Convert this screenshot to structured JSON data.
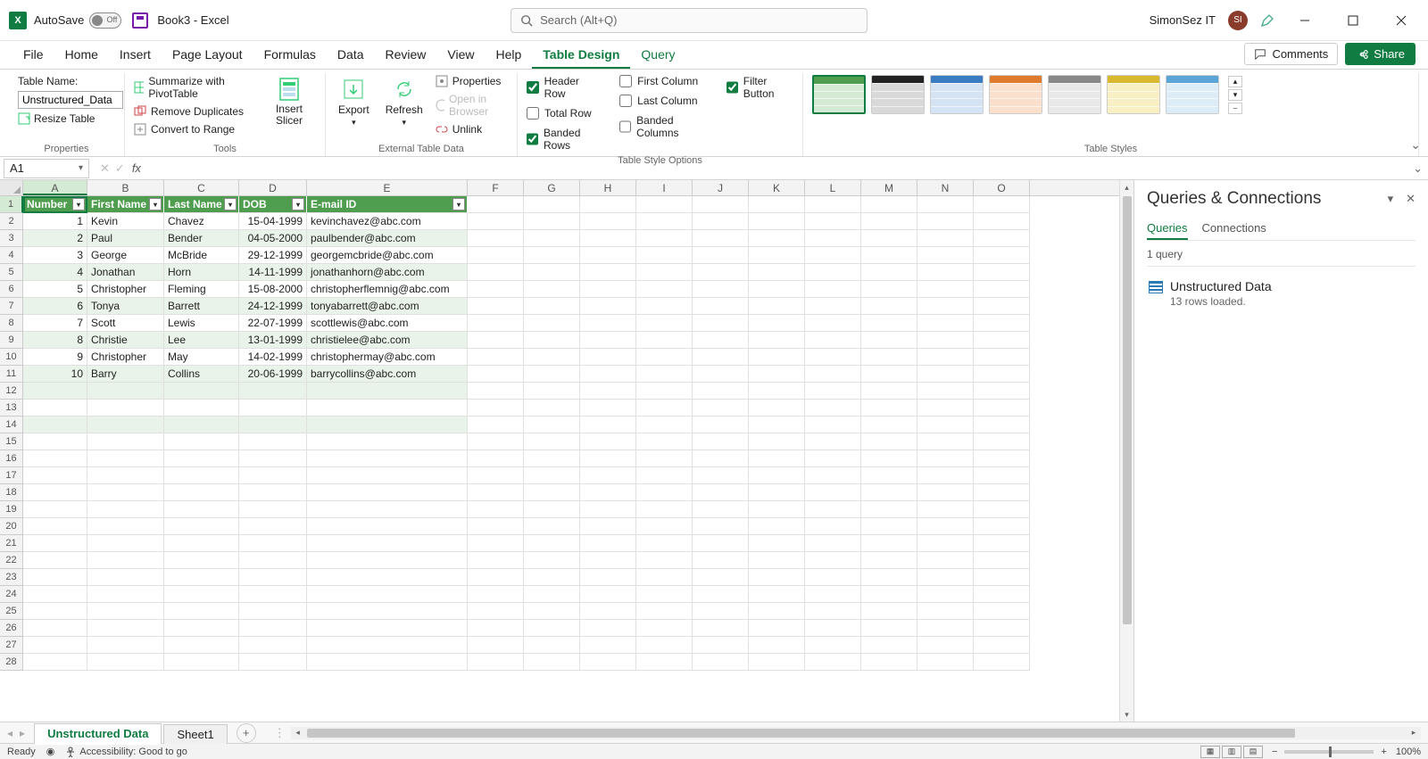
{
  "titlebar": {
    "autosave_label": "AutoSave",
    "autosave_state": "Off",
    "document_title": "Book3  -  Excel",
    "search_placeholder": "Search (Alt+Q)",
    "account_name": "SimonSez IT",
    "account_initials": "SI"
  },
  "ribbon_tabs": [
    "File",
    "Home",
    "Insert",
    "Page Layout",
    "Formulas",
    "Data",
    "Review",
    "View",
    "Help",
    "Table Design",
    "Query"
  ],
  "ribbon_active_tab": "Table Design",
  "ribbon_right": {
    "comments": "Comments",
    "share": "Share"
  },
  "ribbon": {
    "properties": {
      "table_name_label": "Table Name:",
      "table_name_value": "Unstructured_Data",
      "resize_table": "Resize Table",
      "group_label": "Properties"
    },
    "tools": {
      "summarize": "Summarize with PivotTable",
      "remove_dup": "Remove Duplicates",
      "convert_range": "Convert to Range",
      "insert_slicer": "Insert Slicer",
      "group_label": "Tools"
    },
    "external": {
      "export": "Export",
      "refresh": "Refresh",
      "properties": "Properties",
      "open_browser": "Open in Browser",
      "unlink": "Unlink",
      "group_label": "External Table Data"
    },
    "style_options": {
      "header_row": "Header Row",
      "total_row": "Total Row",
      "banded_rows": "Banded Rows",
      "first_col": "First Column",
      "last_col": "Last Column",
      "banded_cols": "Banded Columns",
      "filter_btn": "Filter Button",
      "group_label": "Table Style Options"
    },
    "styles_label": "Table Styles"
  },
  "namebox": "A1",
  "columns": [
    "A",
    "B",
    "C",
    "D",
    "E",
    "F",
    "G",
    "H",
    "I",
    "J",
    "K",
    "L",
    "M",
    "N",
    "O"
  ],
  "table_headers": [
    "Number",
    "First Name",
    "Last Name",
    "DOB",
    "E-mail ID"
  ],
  "rows": [
    {
      "n": "1",
      "fn": "Kevin",
      "ln": "Chavez",
      "dob": "15-04-1999",
      "em": "kevinchavez@abc.com"
    },
    {
      "n": "2",
      "fn": "Paul",
      "ln": "Bender",
      "dob": "04-05-2000",
      "em": "paulbender@abc.com"
    },
    {
      "n": "3",
      "fn": "George",
      "ln": "McBride",
      "dob": "29-12-1999",
      "em": "georgemcbride@abc.com"
    },
    {
      "n": "4",
      "fn": "Jonathan",
      "ln": "Horn",
      "dob": "14-11-1999",
      "em": "jonathanhorn@abc.com"
    },
    {
      "n": "5",
      "fn": "Christopher",
      "ln": "Fleming",
      "dob": "15-08-2000",
      "em": "christopherflemnig@abc.com"
    },
    {
      "n": "6",
      "fn": "Tonya",
      "ln": "Barrett",
      "dob": "24-12-1999",
      "em": "tonyabarrett@abc.com"
    },
    {
      "n": "7",
      "fn": "Scott",
      "ln": "Lewis",
      "dob": "22-07-1999",
      "em": "scottlewis@abc.com"
    },
    {
      "n": "8",
      "fn": "Christie",
      "ln": "Lee",
      "dob": "13-01-1999",
      "em": "christielee@abc.com"
    },
    {
      "n": "9",
      "fn": "Christopher",
      "ln": "May",
      "dob": "14-02-1999",
      "em": "christophermay@abc.com"
    },
    {
      "n": "10",
      "fn": "Barry",
      "ln": "Collins",
      "dob": "20-06-1999",
      "em": "barrycollins@abc.com"
    }
  ],
  "extra_banded_rows": [
    12,
    13,
    14
  ],
  "total_visible_rows": 28,
  "queries_panel": {
    "title": "Queries & Connections",
    "tab_queries": "Queries",
    "tab_connections": "Connections",
    "count_label": "1 query",
    "item_name": "Unstructured Data",
    "item_desc": "13 rows loaded."
  },
  "sheets": {
    "active": "Unstructured Data",
    "others": [
      "Sheet1"
    ]
  },
  "statusbar": {
    "ready": "Ready",
    "accessibility": "Accessibility: Good to go",
    "zoom": "100%"
  }
}
